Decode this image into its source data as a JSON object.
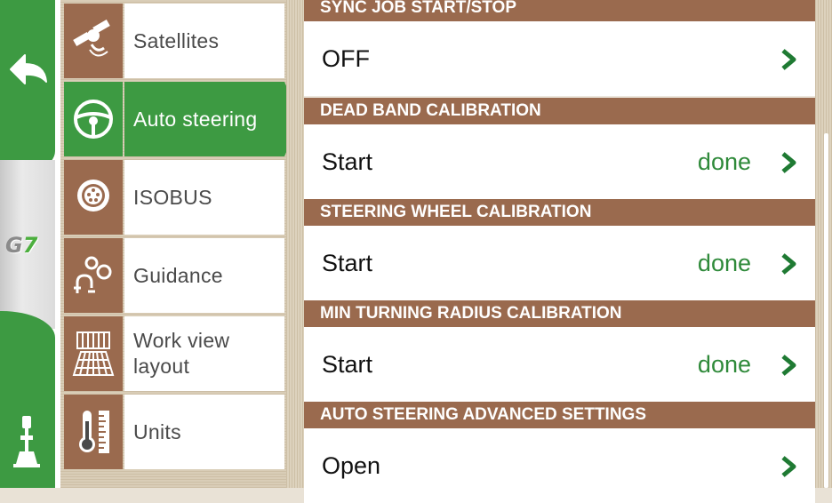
{
  "rail": {
    "logo_text": "G",
    "logo_accent": "7",
    "icons": [
      "back-arrow-icon",
      "joystick-icon"
    ]
  },
  "menu": {
    "items": [
      {
        "label": "Satellites",
        "icon": "satellite-icon"
      },
      {
        "label": "Auto steering",
        "icon": "steering-wheel-icon",
        "active": true
      },
      {
        "label": "ISOBUS",
        "icon": "isobus-icon"
      },
      {
        "label": "Guidance",
        "icon": "guidance-gears-icon"
      },
      {
        "label": "Work view layout",
        "icon": "work-view-grid-icon"
      },
      {
        "label": "Units",
        "icon": "thermometer-ruler-icon"
      }
    ]
  },
  "settings": {
    "sections": [
      {
        "header": "SYNC JOB START/STOP",
        "value": "OFF",
        "status": ""
      },
      {
        "header": "DEAD BAND CALIBRATION",
        "value": "Start",
        "status": "done"
      },
      {
        "header": "STEERING WHEEL CALIBRATION",
        "value": "Start",
        "status": "done"
      },
      {
        "header": "MIN TURNING RADIUS CALIBRATION",
        "value": "Start",
        "status": "done"
      },
      {
        "header": "AUTO STEERING ADVANCED SETTINGS",
        "value": "Open",
        "status": ""
      }
    ]
  },
  "colors": {
    "accent_green": "#3d9a42",
    "header_brown": "#9a6a4e",
    "status_green": "#2f8a3a"
  }
}
